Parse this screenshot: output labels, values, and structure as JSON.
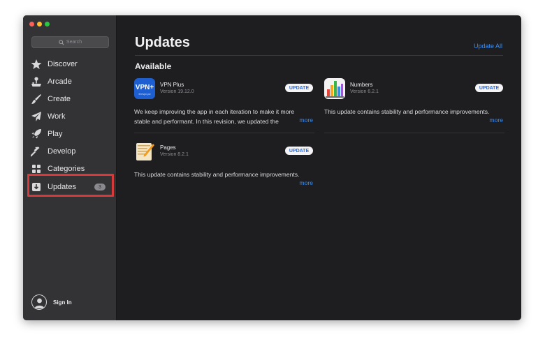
{
  "sidebar": {
    "search_placeholder": "Search",
    "items": [
      {
        "label": "Discover",
        "icon": "star-icon"
      },
      {
        "label": "Arcade",
        "icon": "joystick-icon"
      },
      {
        "label": "Create",
        "icon": "brush-icon"
      },
      {
        "label": "Work",
        "icon": "paper-plane-icon"
      },
      {
        "label": "Play",
        "icon": "rocket-icon"
      },
      {
        "label": "Develop",
        "icon": "hammer-icon"
      },
      {
        "label": "Categories",
        "icon": "grid-icon"
      },
      {
        "label": "Updates",
        "icon": "download-icon",
        "badge": "3"
      }
    ],
    "sign_in": "Sign In"
  },
  "main": {
    "title": "Updates",
    "update_all": "Update All",
    "section": "Available",
    "apps": [
      {
        "name": "VPN Plus",
        "version": "Version 19.12.0",
        "button": "UPDATE",
        "description": "We keep improving the app in each iteration to make it more stable and performant. In this revision, we updated the",
        "more": "more",
        "icon_text": "VPN+",
        "icon_subtext": "freevpn.pw"
      },
      {
        "name": "Numbers",
        "version": "Version 6.2.1",
        "button": "UPDATE",
        "description": "This update contains stability and performance improvements.",
        "more": "more"
      },
      {
        "name": "Pages",
        "version": "Version 8.2.1",
        "button": "UPDATE",
        "description": "This update contains stability and performance improvements.",
        "more": "more"
      }
    ]
  },
  "colors": {
    "accent": "#3a8ef6",
    "highlight": "#d63a3a",
    "sidebar_bg": "#333335",
    "main_bg": "#1e1e20"
  }
}
